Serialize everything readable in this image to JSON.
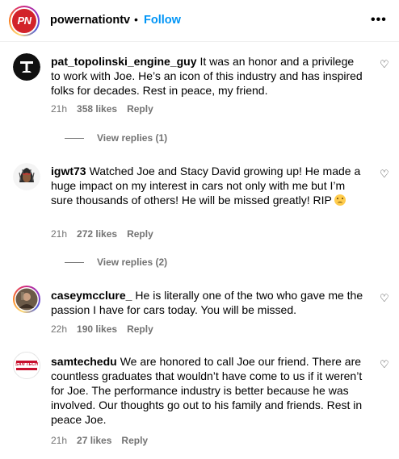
{
  "header": {
    "avatar_text": "PN",
    "username": "powernationtv",
    "separator": "•",
    "follow_label": "Follow",
    "more_label": "•••"
  },
  "comments": [
    {
      "username": "pat_topolinski_engine_guy",
      "text": "It was an honor and a privilege to work with Joe. He’s an icon of this industry and has inspired folks for decades. Rest in peace, my friend.",
      "time": "21h",
      "likes": "358 likes",
      "reply": "Reply",
      "view_replies": "View replies (1)",
      "avatar_icon": "anvil-logo-icon"
    },
    {
      "username": "igwt73",
      "text": "Watched Joe and Stacy David growing up! He made a huge impact on my interest in cars not only with me but I’m sure thousands of others! He will be missed greatly! RIP",
      "time": "21h",
      "likes": "272 likes",
      "reply": "Reply",
      "view_replies": "View replies (2)",
      "avatar_icon": "headdress-icon"
    },
    {
      "username": "caseymcclure_",
      "text": "He is literally one of the two who gave me the passion I have for cars today. You will be missed.",
      "time": "22h",
      "likes": "190 likes",
      "reply": "Reply",
      "avatar_icon": "profile-photo"
    },
    {
      "username": "samtechedu",
      "text": "We are honored to call Joe our friend. There are countless graduates that wouldn’t have come to us if it weren’t for Joe. The performance industry is better because he was involved. Our thoughts go out to his family and friends. Rest in peace Joe.",
      "time": "21h",
      "likes": "27 likes",
      "reply": "Reply",
      "avatar_text": "SAN TECH",
      "avatar_icon": "school-logo-icon"
    }
  ],
  "colors": {
    "follow": "#0095f6",
    "meta": "#737373",
    "brand": "#d2232a"
  }
}
